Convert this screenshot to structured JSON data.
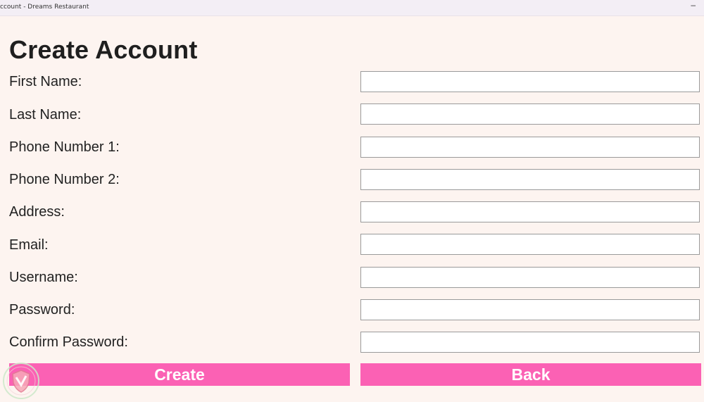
{
  "window": {
    "title": "ccount - Dreams Restaurant",
    "minimize_glyph": "–"
  },
  "form": {
    "heading": "Create Account",
    "fields": [
      {
        "label": "First Name:",
        "value": "",
        "placeholder": ""
      },
      {
        "label": "Last Name:",
        "value": "",
        "placeholder": ""
      },
      {
        "label": "Phone Number 1:",
        "value": "",
        "placeholder": ""
      },
      {
        "label": "Phone Number 2:",
        "value": "",
        "placeholder": ""
      },
      {
        "label": "Address:",
        "value": "",
        "placeholder": ""
      },
      {
        "label": "Email:",
        "value": "",
        "placeholder": ""
      },
      {
        "label": "Username:",
        "value": "",
        "placeholder": ""
      },
      {
        "label": "Password:",
        "value": "",
        "placeholder": ""
      },
      {
        "label": "Confirm Password:",
        "value": "",
        "placeholder": ""
      }
    ],
    "create_label": "Create",
    "back_label": "Back"
  },
  "colors": {
    "background": "#fdf4f0",
    "button": "#fb61b4",
    "button_text": "#ffffff"
  },
  "icons": {
    "watermark": "shield-logo-icon"
  }
}
